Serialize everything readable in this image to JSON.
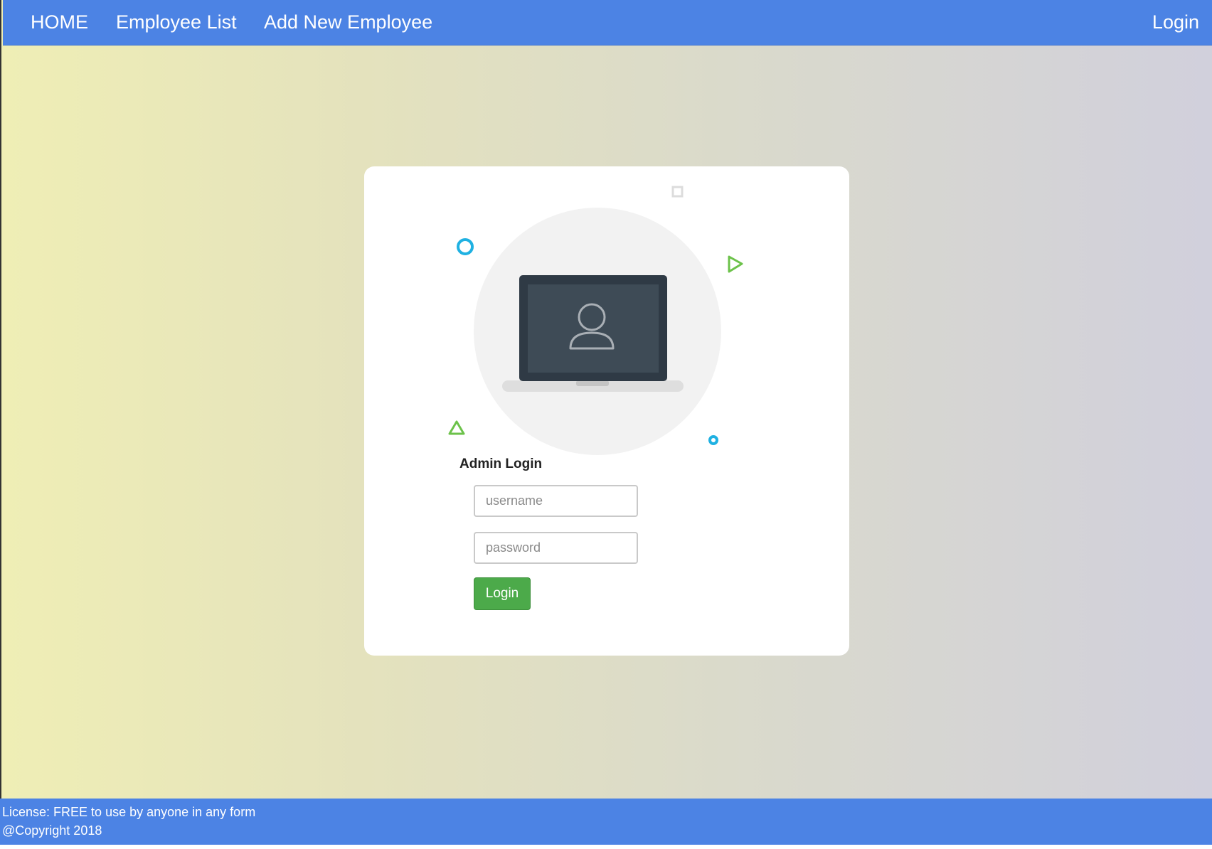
{
  "nav": {
    "home": "HOME",
    "employee_list": "Employee List",
    "add_employee": "Add New Employee",
    "login": "Login"
  },
  "login_form": {
    "title": "Admin Login",
    "username_placeholder": "username",
    "password_placeholder": "password",
    "submit_label": "Login"
  },
  "footer": {
    "license": "License: FREE to use by anyone in any form",
    "copyright": "@Copyright 2018"
  },
  "icons": {
    "illustration": "laptop-user-icon",
    "decorations": [
      "circle-icon",
      "triangle-icon",
      "square-icon",
      "play-triangle-icon",
      "dot-icon"
    ]
  },
  "colors": {
    "navbar": "#4c83e4",
    "login_button": "#4caa4a",
    "accent_blue": "#1fb1e2",
    "accent_green": "#6cc24a"
  }
}
